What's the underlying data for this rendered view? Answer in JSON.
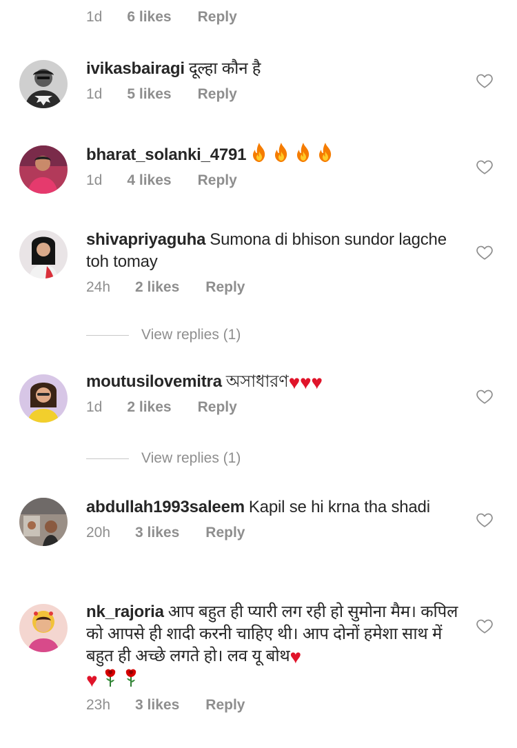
{
  "top_meta": {
    "time": "1d",
    "likes": "6 likes",
    "reply": "Reply"
  },
  "comments": [
    {
      "username": "ivikasbairagi",
      "text": "दूल्हा कौन है",
      "time": "1d",
      "likes": "5 likes",
      "reply": "Reply"
    },
    {
      "username": "bharat_solanki_4791",
      "text": "",
      "emoji": [
        "fire",
        "fire",
        "fire",
        "fire"
      ],
      "time": "1d",
      "likes": "4 likes",
      "reply": "Reply"
    },
    {
      "username": "shivapriyaguha",
      "text": "Sumona di bhison sundor lagche toh tomay",
      "time": "24h",
      "likes": "2 likes",
      "reply": "Reply",
      "view_replies": "View replies (1)"
    },
    {
      "username": "moutusilovemitra",
      "text": "অসাধারণ",
      "emoji": [
        "red-heart",
        "red-heart",
        "red-heart"
      ],
      "time": "1d",
      "likes": "2 likes",
      "reply": "Reply",
      "view_replies": "View replies (1)"
    },
    {
      "username": "abdullah1993saleem",
      "text": "Kapil se hi krna tha shadi",
      "time": "20h",
      "likes": "3 likes",
      "reply": "Reply"
    },
    {
      "username": "nk_rajoria",
      "text": "आप बहुत ही प्यारी लग रही हो सुमोना मैम। कपिल को आपसे ही शादी करनी चाहिए थी। आप दोनों हमेशा साथ में बहुत ही अच्छे लगते हो। लव यू बोथ",
      "emoji": [
        "red-heart",
        "red-heart",
        "rose",
        "rose"
      ],
      "time": "23h",
      "likes": "3 likes",
      "reply": "Reply"
    }
  ],
  "colors": {
    "text": "#262626",
    "meta": "#8e8e8e",
    "heart_emoji": "#e0142a",
    "divider": "#c7c7c7"
  },
  "icons": {
    "like": "heart-outline-icon",
    "fire": "fire-emoji-icon",
    "heart": "red-heart-emoji-icon",
    "rose": "rose-emoji-icon"
  }
}
